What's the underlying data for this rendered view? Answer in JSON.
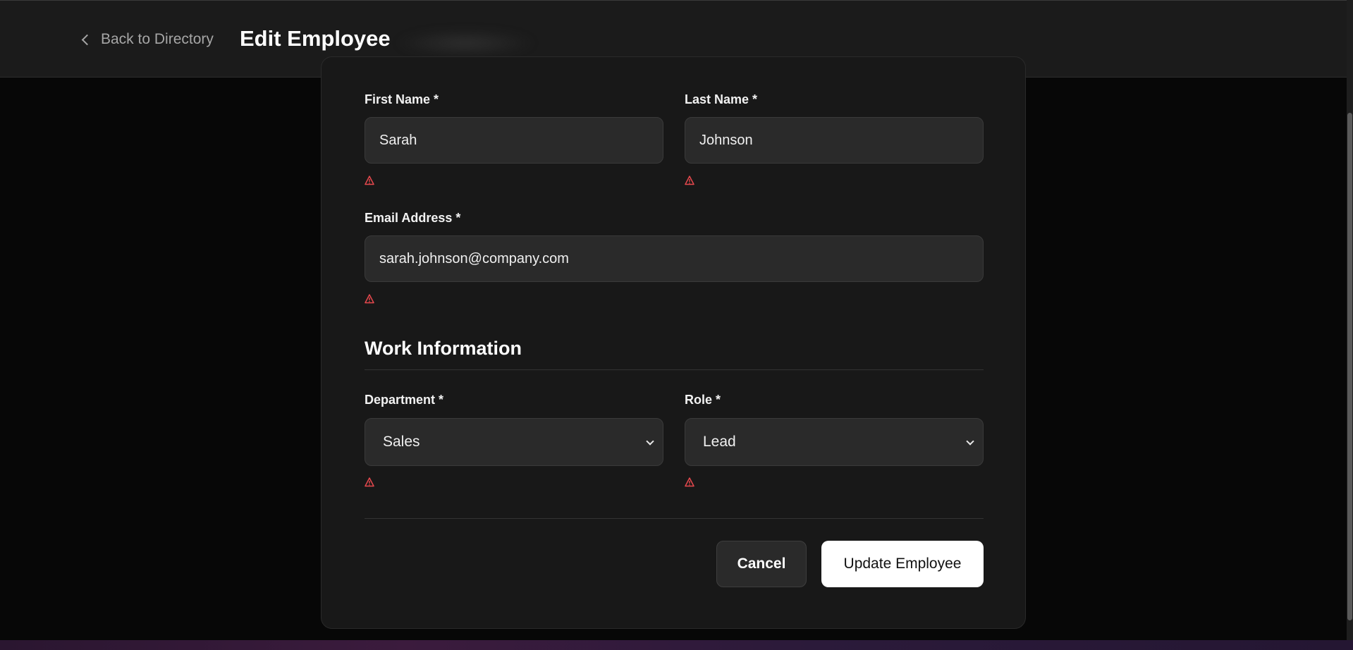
{
  "header": {
    "back_label": "Back to Directory",
    "title": "Edit Employee"
  },
  "form": {
    "first_name": {
      "label": "First Name *",
      "value": "Sarah"
    },
    "last_name": {
      "label": "Last Name *",
      "value": "Johnson"
    },
    "email": {
      "label": "Email Address *",
      "value": "sarah.johnson@company.com"
    },
    "work_section_title": "Work Information",
    "department": {
      "label": "Department *",
      "selected": "Sales"
    },
    "role": {
      "label": "Role *",
      "selected": "Lead"
    }
  },
  "actions": {
    "cancel_label": "Cancel",
    "update_label": "Update Employee"
  },
  "colors": {
    "warning": "#e5484d",
    "background": "#070707",
    "card": "#181818",
    "input": "#2a2a2a"
  },
  "icons": [
    "chevron-left-icon",
    "warning-icon",
    "chevron-down-icon"
  ]
}
